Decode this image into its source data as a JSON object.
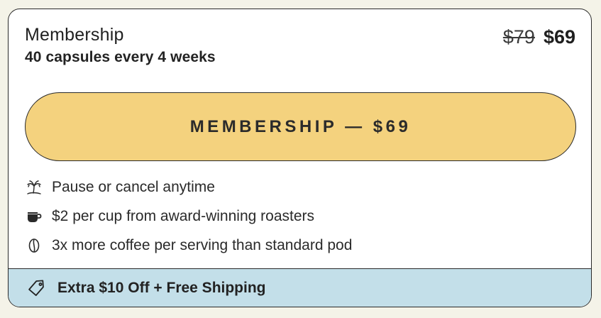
{
  "plan": {
    "title": "Membership",
    "subtitle": "40 capsules every 4 weeks",
    "price_original": "$79",
    "price_current": "$69"
  },
  "cta": {
    "label": "MEMBERSHIP — $69"
  },
  "benefits": [
    {
      "icon": "palm-tree-icon",
      "text": "Pause or cancel anytime"
    },
    {
      "icon": "coffee-cup-icon",
      "text": "$2 per cup from award-winning roasters"
    },
    {
      "icon": "coffee-bean-icon",
      "text": "3x more coffee per serving than standard pod"
    }
  ],
  "promo": {
    "icon": "tag-icon",
    "text": "Extra $10 Off + Free Shipping"
  },
  "colors": {
    "page_background": "#f4f3e8",
    "card_background": "#ffffff",
    "cta_background": "#f4d27e",
    "promo_background": "#c3dfe9",
    "border": "#2a2a2a"
  }
}
